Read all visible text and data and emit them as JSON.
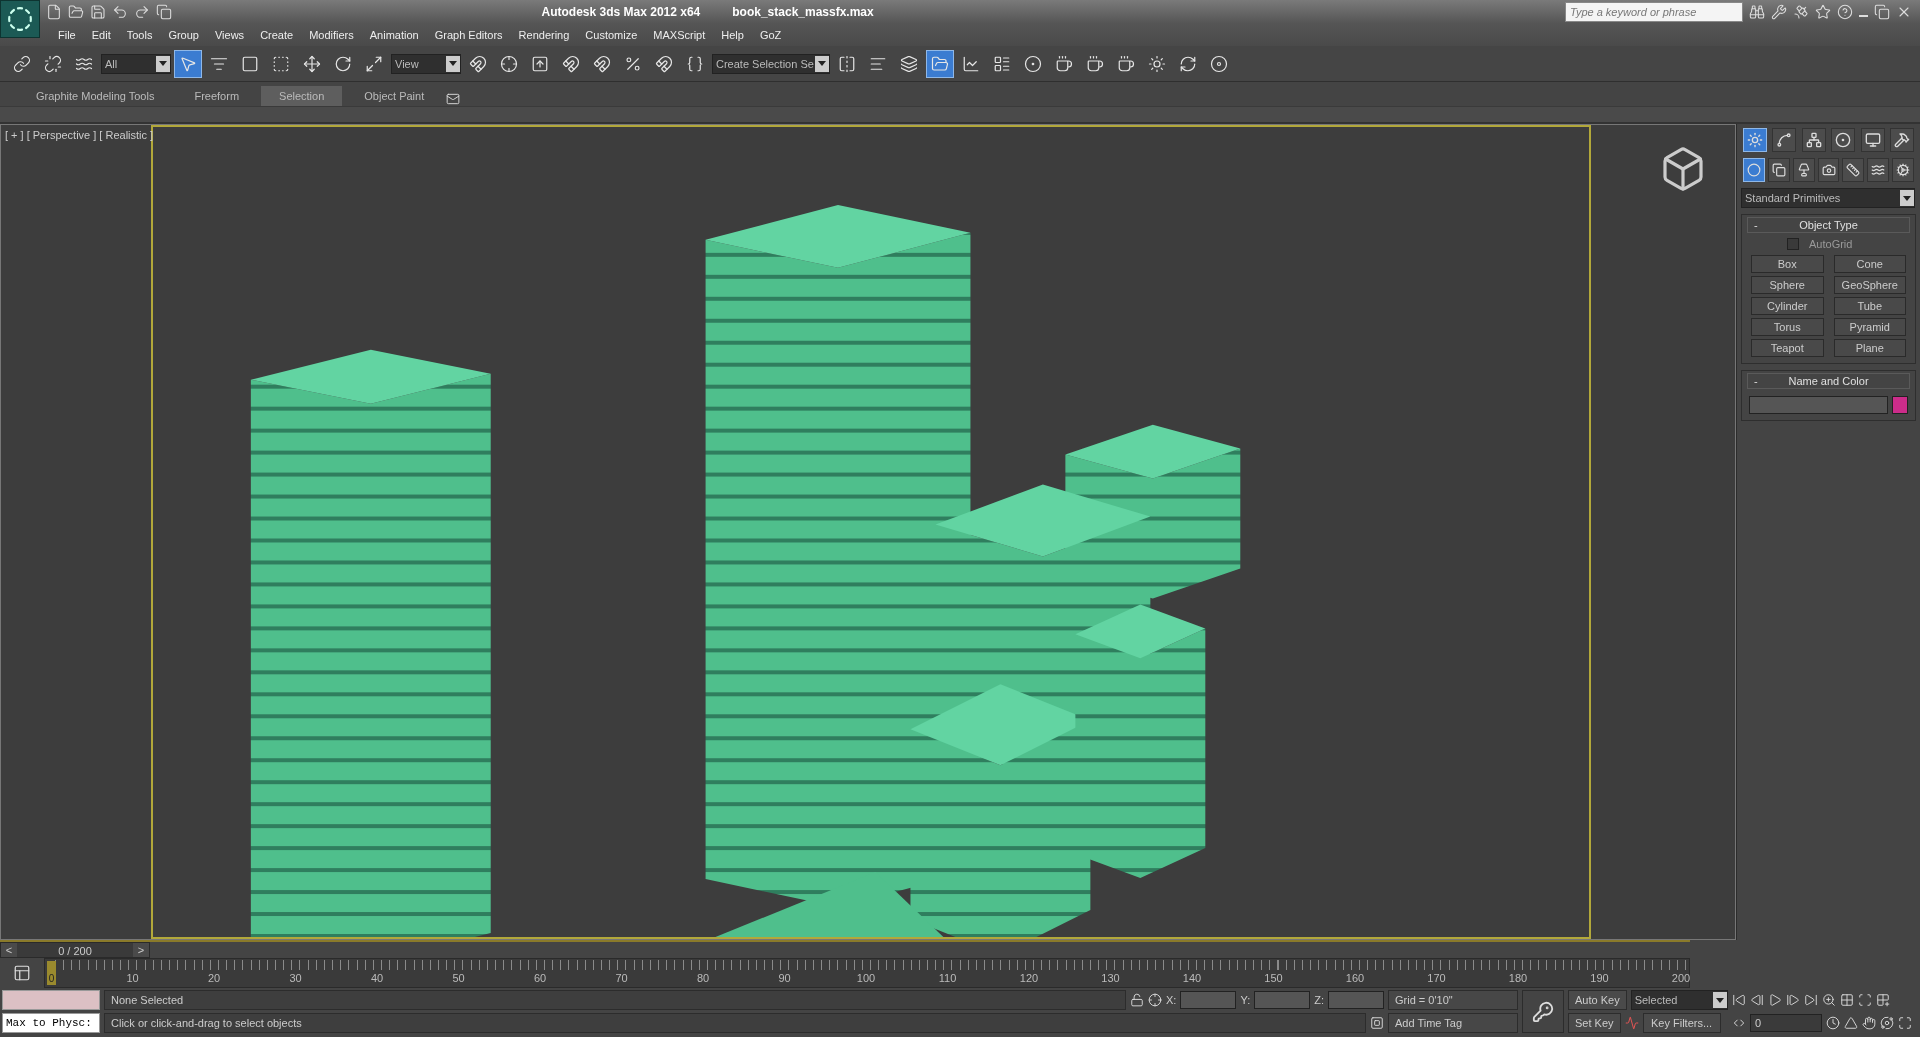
{
  "title_bar": {
    "app_title": "Autodesk 3ds Max  2012 x64",
    "file_name": "book_stack_massfx.max",
    "search": {
      "placeholder": "Type a keyword or phrase"
    }
  },
  "menu": [
    "File",
    "Edit",
    "Tools",
    "Group",
    "Views",
    "Create",
    "Modifiers",
    "Animation",
    "Graph Editors",
    "Rendering",
    "Customize",
    "MAXScript",
    "Help",
    "GoZ"
  ],
  "toolbar": [
    {
      "kind": "tool",
      "selected": false
    },
    {
      "kind": "tool",
      "selected": false
    },
    {
      "kind": "tool",
      "selected": false
    },
    {
      "kind": "dropdown",
      "value": "All"
    },
    {
      "kind": "tool",
      "selected": true
    },
    {
      "kind": "tool",
      "selected": false
    },
    {
      "kind": "tool",
      "selected": false
    },
    {
      "kind": "tool",
      "selected": false
    },
    {
      "kind": "tool",
      "selected": false
    },
    {
      "kind": "tool",
      "selected": false
    },
    {
      "kind": "tool",
      "selected": false
    },
    {
      "kind": "dropdown",
      "value": "View"
    },
    {
      "kind": "tool",
      "selected": false
    },
    {
      "kind": "tool",
      "selected": false
    },
    {
      "kind": "tool",
      "selected": false
    },
    {
      "kind": "tool",
      "selected": false
    },
    {
      "kind": "tool",
      "selected": false
    },
    {
      "kind": "tool",
      "selected": false
    },
    {
      "kind": "tool",
      "selected": false
    },
    {
      "kind": "tool",
      "selected": false
    },
    {
      "kind": "dropdown",
      "value": "Create Selection Se"
    },
    {
      "kind": "tool",
      "selected": false
    },
    {
      "kind": "tool",
      "selected": false
    },
    {
      "kind": "tool",
      "selected": false
    },
    {
      "kind": "tool",
      "selected": true
    },
    {
      "kind": "tool",
      "selected": false
    },
    {
      "kind": "tool",
      "selected": false
    },
    {
      "kind": "tool",
      "selected": false
    },
    {
      "kind": "tool",
      "selected": false
    },
    {
      "kind": "tool",
      "selected": false
    },
    {
      "kind": "tool",
      "selected": false
    },
    {
      "kind": "tool",
      "selected": false
    },
    {
      "kind": "tool",
      "selected": false
    },
    {
      "kind": "tool",
      "selected": false
    }
  ],
  "ribbon_tabs": [
    {
      "label": "Graphite Modeling Tools",
      "selected": false
    },
    {
      "label": "Freeform",
      "selected": false
    },
    {
      "label": "Selection",
      "selected": true
    },
    {
      "label": "Object Paint",
      "selected": false
    }
  ],
  "viewport": {
    "labels": [
      "[ + ]",
      "[ Perspective ]",
      "[ Realistic ]"
    ]
  },
  "command_panel": {
    "tabs": [
      {
        "selected": true
      },
      {
        "selected": false
      },
      {
        "selected": false
      },
      {
        "selected": false
      },
      {
        "selected": false
      },
      {
        "selected": false
      }
    ],
    "categories": [
      {
        "selected": true
      },
      {
        "selected": false
      },
      {
        "selected": false
      },
      {
        "selected": false
      },
      {
        "selected": false
      },
      {
        "selected": false
      },
      {
        "selected": false
      }
    ],
    "dropdown": "Standard Primitives",
    "object_type": {
      "title": "Object Type",
      "collapse": "-",
      "autogrid": {
        "label": "AutoGrid",
        "checked": false
      },
      "buttons": [
        "Box",
        "Cone",
        "Sphere",
        "GeoSphere",
        "Cylinder",
        "Tube",
        "Torus",
        "Pyramid",
        "Teapot",
        "Plane"
      ]
    },
    "name_and_color": {
      "title": "Name and Color",
      "collapse": "-",
      "color": "#cc2c8a"
    }
  },
  "time_slider": {
    "level": 0,
    "prev": "<",
    "position": "0 / 200",
    "next": ">"
  },
  "track_bar": {
    "current": "0",
    "labels": [
      "10",
      "20",
      "30",
      "40",
      "50",
      "60",
      "70",
      "80",
      "90",
      "100",
      "110",
      "120",
      "130",
      "140",
      "150",
      "160",
      "170",
      "180",
      "190",
      "200"
    ]
  },
  "status_bar": {
    "listener": "Max to Physc:",
    "selection": "None Selected",
    "prompt": "Click or click-and-drag to select objects",
    "coords": [
      "X:",
      "Y:",
      "Z:"
    ],
    "grid": "Grid = 0'10\"",
    "add_time_tag": "Add Time Tag",
    "auto_key": "Auto Key",
    "key_mode": "Selected",
    "set_key": "Set Key",
    "key_filters": "Key Filters...",
    "frame": "0"
  }
}
